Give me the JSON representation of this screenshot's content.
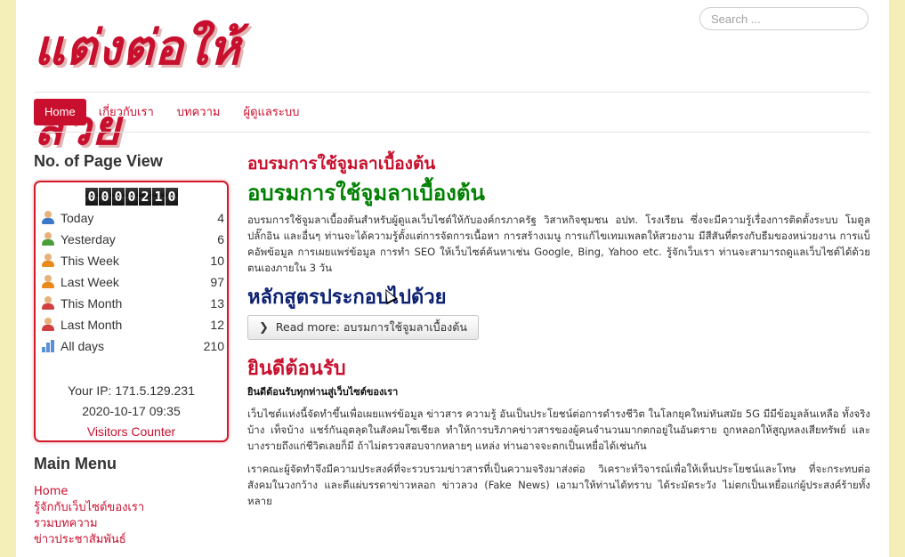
{
  "header": {
    "logo_text": "แต่งต่อให้สวย",
    "search_placeholder": "Search ..."
  },
  "nav": {
    "items": [
      {
        "label": "Home",
        "active": true
      },
      {
        "label": "เกี่ยวกับเรา",
        "active": false
      },
      {
        "label": "บทความ",
        "active": false
      },
      {
        "label": "ผู้ดูแลระบบ",
        "active": false
      }
    ]
  },
  "sidebar": {
    "pageview_title": "No. of Page View",
    "counter_digits": [
      "0",
      "0",
      "0",
      "0",
      "2",
      "1",
      "0"
    ],
    "stats": [
      {
        "label": "Today",
        "value": "4",
        "icon": "person-blue-icon"
      },
      {
        "label": "Yesterday",
        "value": "6",
        "icon": "person-green-icon"
      },
      {
        "label": "This Week",
        "value": "10",
        "icon": "person-orange-icon"
      },
      {
        "label": "Last Week",
        "value": "97",
        "icon": "person-orange-icon"
      },
      {
        "label": "This Month",
        "value": "13",
        "icon": "person-red-icon"
      },
      {
        "label": "Last Month",
        "value": "12",
        "icon": "person-red-icon"
      },
      {
        "label": "All days",
        "value": "210",
        "icon": "bar-chart-icon"
      }
    ],
    "your_ip": "Your IP: 171.5.129.231",
    "datetime": "2020-10-17 09:35",
    "visitors_counter": "Visitors Counter",
    "main_menu_title": "Main Menu",
    "main_menu": [
      "Home",
      "รู้จักกับเว็บไซต์ของเรา",
      "รวมบทความ",
      "ข่าวประชาสัมพันธ์"
    ]
  },
  "main": {
    "page_heading": "อบรมการใช้จูมลาเบื้องต้น",
    "article_title": "อบรมการใช้จูมลาเบื้องต้น",
    "article_body": "อบรมการใช้จูมลาเบื้องต้นสำหรับผู้ดูแลเว็บไซต์ให้กับองค์กรภาครัฐ วิสาหกิจชุมชน อปท. โรงเรียน ซึ่งจะมีความรู้เรื่องการติดตั้งระบบ โมดูล ปลั๊กอิน และอื่นๆ ท่านจะได้ความรู้ตั้งแต่การจัดการเนื้อหา การสร้างเมนู การแก้ไขเทมเพลตให้สวยงาม มีสีสันที่ตรงกับธีมของหน่วยงาน การแบ็คอัพข้อมูล การเผยแพร่ข้อมูล การทำ SEO ให้เว็บไซต์ค้นหาเช่น Google, Bing, Yahoo etc. รู้จักเว็บเรา ท่านจะสามารถดูแลเว็บไซต์ได้ด้วยตนเองภายใน 3 วัน",
    "course_heading": "หลักสูตรประกอบไปด้วย",
    "read_more": "Read more: อบรมการใช้จูมลาเบื้องต้น",
    "welcome_heading": "ยินดีต้อนรับ",
    "welcome_subtitle": "ยินดีต้อนรับทุกท่านสู่เว็บไซต์ของเรา",
    "welcome_p1": "เว็บไซต์แห่งนี้จัดทำขึ้นเพื่อเผยแพร่ข้อมูล ข่าวสาร ความรู้ อันเป็นประโยชน์ต่อการดำรงชีวิต ในโลกยุคใหม่ทันสมัย 5G มีมีข้อมูลล้นเหลือ ทั้งจริงบ้าง เท็จบ้าง แชร์กันอุตลุดในสังคมโซเชียล ทำให้การบริภาคข่าวสารของผู้คนจำนวนมากตกอยู่ในอันตราย ถูกหลอกให้สูญหลงเสียทรัพย์ และบางรายถึงแก่ชีวิตเลยก็มี ถ้าไม่ตรวจสอบจากหลายๆ แหล่ง ท่านอาจจะตกเป็นเหยื่อได้เช่นกัน",
    "welcome_p2": "เราคณะผู้จัดทำจึงมีความประสงค์ที่จะรวบรวมข่าวสารที่เป็นความจริงมาส่งต่อ วิเคราะห์วิจารณ์เพื่อให้เห็นประโยชน์และโทษ ที่จะกระทบต่อสังคมในวงกว้าง และตีแผ่บรรดาข่าวหลอก ข่าวลวง (Fake News) เอามาให้ท่านได้ทราบ ได้ระมัดระวัง ไม่ตกเป็นเหยื่อแก่ผู้ประสงค์ร้ายทั้งหลาย"
  },
  "colors": {
    "accent_red": "#c8102e",
    "green_title": "#008000",
    "navy_title": "#0b1f73",
    "page_bg": "#f4eeb9"
  }
}
